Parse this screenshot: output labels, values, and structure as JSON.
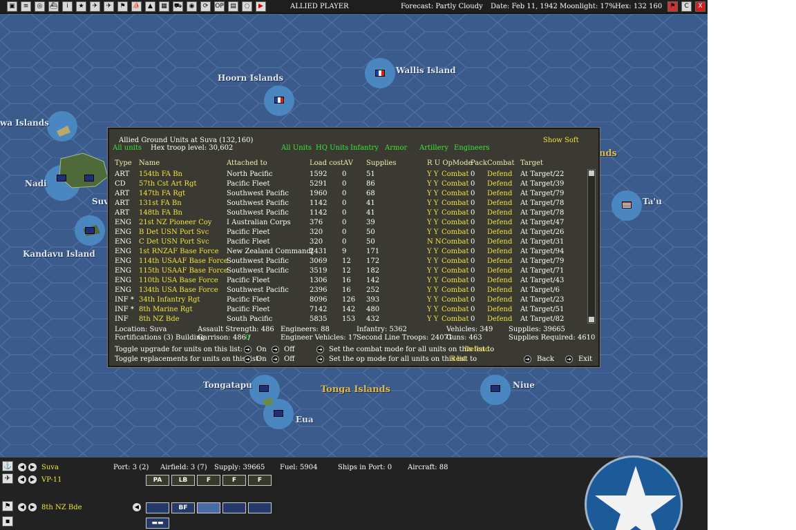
{
  "topbar": {
    "title": "ALLIED PLAYER",
    "forecast": "Forecast: Partly Cloudy",
    "date": "Date: Feb 11, 1942",
    "moonlight": "Moonlight: 17%",
    "hex": "Hex: 132 160",
    "icons": [
      "save-icon",
      "document-icon",
      "globe-icon",
      "ship-icon",
      "info-icon",
      "star-icon",
      "plane-icon",
      "aircraft-icon",
      "flag-icon",
      "carrier-icon",
      "airbase-icon",
      "map-icon",
      "truck-icon",
      "earth-icon",
      "recycle-icon",
      "options-icon",
      "report-icon",
      "air-icon",
      "end-turn-icon"
    ],
    "right_icons": [
      "flag-icon",
      "c-icon",
      "close-icon"
    ],
    "right_labels": [
      "",
      "C",
      "X"
    ]
  },
  "map": {
    "labels": {
      "hoorn": "Hoorn Islands",
      "wallis": "Wallis Island",
      "wa_islands": "wa Islands",
      "nadi": "Nadi",
      "suva": "Suv",
      "kandavu": "Kandavu Island",
      "tau": "Ta'u",
      "nds": "nds",
      "tongatapu": "Tongatapu",
      "tonga": "Tonga Islands",
      "niue": "Niue",
      "eua": "Eua"
    }
  },
  "dialog": {
    "title": "Allied Ground Units at Suva (132,160)",
    "all_units": "All units",
    "troop_level": "Hex troop level: 30,602",
    "filters": [
      "All Units",
      "HQ Units",
      "Infantry",
      "Armor",
      "Artillery",
      "Engineers"
    ],
    "show_soft": "Show Soft",
    "columns": [
      "Type",
      "Name",
      "Attached to",
      "Load cost",
      "AV",
      "Supplies",
      "R U OpMode",
      "Pack",
      "Combat",
      "Target"
    ],
    "rows": [
      {
        "type": "ART",
        "name": "154th FA Bn",
        "attached": "North Pacific",
        "load": "1592",
        "av": "0",
        "supplies": "51",
        "ru": "Y Y",
        "opmode": "Combat",
        "pack": "0",
        "combat": "Defend",
        "target": "At Target/22"
      },
      {
        "type": "CD",
        "name": "57th Cst Art Rgt",
        "attached": "Pacific Fleet",
        "load": "5291",
        "av": "0",
        "supplies": "86",
        "ru": "Y Y",
        "opmode": "Combat",
        "pack": "0",
        "combat": "Defend",
        "target": "At Target/39"
      },
      {
        "type": "ART",
        "name": "147th FA Rgt",
        "attached": "Southwest Pacific",
        "load": "1960",
        "av": "0",
        "supplies": "68",
        "ru": "Y Y",
        "opmode": "Combat",
        "pack": "0",
        "combat": "Defend",
        "target": "At Target/79"
      },
      {
        "type": "ART",
        "name": "131st FA Bn",
        "attached": "Southwest Pacific",
        "load": "1142",
        "av": "0",
        "supplies": "41",
        "ru": "Y Y",
        "opmode": "Combat",
        "pack": "0",
        "combat": "Defend",
        "target": "At Target/78"
      },
      {
        "type": "ART",
        "name": "148th FA Bn",
        "attached": "Southwest Pacific",
        "load": "1142",
        "av": "0",
        "supplies": "41",
        "ru": "Y Y",
        "opmode": "Combat",
        "pack": "0",
        "combat": "Defend",
        "target": "At Target/78"
      },
      {
        "type": "ENG",
        "name": "21st NZ Pioneer Coy",
        "attached": "I Australian Corps",
        "load": "376",
        "av": "0",
        "supplies": "39",
        "ru": "Y Y",
        "opmode": "Combat",
        "pack": "0",
        "combat": "Defend",
        "target": "At Target/47"
      },
      {
        "type": "ENG",
        "name": "B Det USN Port Svc",
        "attached": "Pacific Fleet",
        "load": "320",
        "av": "0",
        "supplies": "50",
        "ru": "Y Y",
        "opmode": "Combat",
        "pack": "0",
        "combat": "Defend",
        "target": "At Target/26"
      },
      {
        "type": "ENG",
        "name": "C Det USN Port Svc",
        "attached": "Pacific Fleet",
        "load": "320",
        "av": "0",
        "supplies": "50",
        "ru": "N N",
        "opmode": "Combat",
        "pack": "0",
        "combat": "Defend",
        "target": "At Target/31"
      },
      {
        "type": "ENG",
        "name": "1st RNZAF Base Force",
        "attached": "New Zealand Command[",
        "load": "2431",
        "av": "9",
        "supplies": "171",
        "ru": "Y Y",
        "opmode": "Combat",
        "pack": "0",
        "combat": "Defend",
        "target": "At Target/94"
      },
      {
        "type": "ENG",
        "name": "114th USAAF Base Force",
        "attached": "Southwest Pacific",
        "load": "3069",
        "av": "12",
        "supplies": "172",
        "ru": "Y Y",
        "opmode": "Combat",
        "pack": "0",
        "combat": "Defend",
        "target": "At Target/79"
      },
      {
        "type": "ENG",
        "name": "115th USAAF Base Force",
        "attached": "Southwest Pacific",
        "load": "3519",
        "av": "12",
        "supplies": "182",
        "ru": "Y Y",
        "opmode": "Combat",
        "pack": "0",
        "combat": "Defend",
        "target": "At Target/71"
      },
      {
        "type": "ENG",
        "name": "110th USA Base Force",
        "attached": "Pacific Fleet",
        "load": "1306",
        "av": "16",
        "supplies": "142",
        "ru": "Y Y",
        "opmode": "Combat",
        "pack": "0",
        "combat": "Defend",
        "target": "At Target/43"
      },
      {
        "type": "ENG",
        "name": "134th USA Base Force",
        "attached": "Southwest Pacific",
        "load": "2396",
        "av": "16",
        "supplies": "252",
        "ru": "Y Y",
        "opmode": "Combat",
        "pack": "0",
        "combat": "Defend",
        "target": "At Target/6"
      },
      {
        "type": "INF *",
        "name": "34th Infantry Rgt",
        "attached": "Pacific Fleet",
        "load": "8096",
        "av": "126",
        "supplies": "393",
        "ru": "Y Y",
        "opmode": "Combat",
        "pack": "0",
        "combat": "Defend",
        "target": "At Target/23"
      },
      {
        "type": "INF *",
        "name": "8th Marine Rgt",
        "attached": "Pacific Fleet",
        "load": "7142",
        "av": "142",
        "supplies": "480",
        "ru": "Y Y",
        "opmode": "Combat",
        "pack": "0",
        "combat": "Defend",
        "target": "At Target/51"
      },
      {
        "type": "INF",
        "name": "8th NZ Bde",
        "attached": "South Pacific",
        "load": "5835",
        "av": "153",
        "supplies": "432",
        "ru": "Y Y",
        "opmode": "Combat",
        "pack": "0",
        "combat": "Defend",
        "target": "At Target/82"
      }
    ],
    "summary": {
      "location": "Location: Suva",
      "assault": "Assault Strength: 486",
      "engineers": "Engineers: 88",
      "infantry": "Infantry: 5362",
      "vehicles": "Vehicles: 349",
      "supplies": "Supplies: 39665",
      "fortifications": "Fortifications (3) Building",
      "garrison": "Garrison: 486 /",
      "garrison_val": "0",
      "eng_vehicles": "Engineer Vehicles: 17",
      "second_line": "Second Line Troops: 24071",
      "guns": "Guns: 463",
      "supplies_req": "Supplies Required: 4610"
    },
    "toggles": {
      "upgrade": "Toggle upgrade for units on this list:",
      "replacements": "Toggle replacements for units on this list:",
      "on": "On",
      "off": "Off",
      "combat_mode": "Set the combat mode for all units on this list to",
      "combat_mode_val": "Defend",
      "op_mode": "Set the op mode for all units on this list to",
      "op_mode_val": "Rest",
      "back": "Back",
      "exit": "Exit"
    }
  },
  "bottom": {
    "base_name": "Suva",
    "port": "Port: 3 (2)",
    "airfield": "Airfield: 3 (7)",
    "supply": "Supply: 39665",
    "fuel": "Fuel: 5904",
    "ships": "Ships in Port: 0",
    "aircraft": "Aircraft: 88",
    "squadron": "VP-11",
    "unit": "8th NZ Bde",
    "air_units": [
      "PA",
      "LB",
      "F",
      "F",
      "F"
    ],
    "land_units": [
      "",
      "BF",
      "",
      "",
      ""
    ]
  }
}
